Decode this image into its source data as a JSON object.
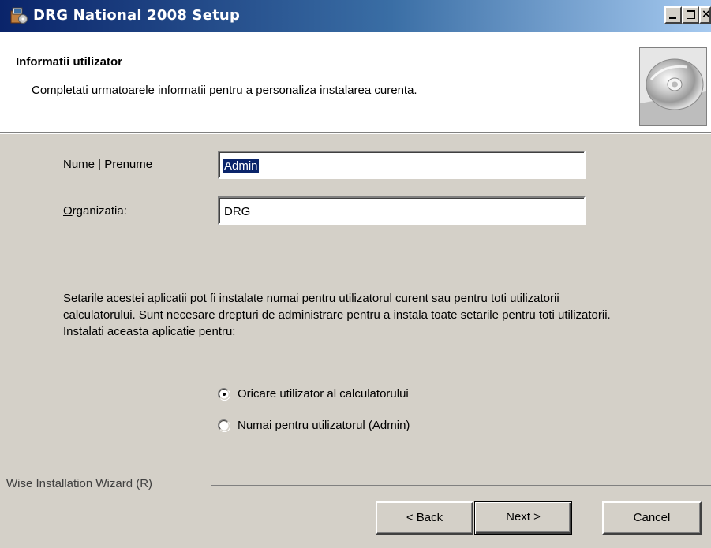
{
  "window": {
    "title": "DRG National 2008 Setup",
    "icon": "installer-icon",
    "controls": {
      "minimize": "minimize-icon",
      "maximize": "maximize-icon",
      "close": "×"
    }
  },
  "header": {
    "title": "Informatii utilizator",
    "subtitle": "Completati urmatoarele informatii pentru a personaliza instalarea curenta.",
    "image": "cd-disc-icon"
  },
  "form": {
    "name_label": "Nume | Prenume",
    "name_value": "Admin",
    "org_label_mnemonic": "O",
    "org_label_rest": "rganizatia:",
    "org_value": "DRG"
  },
  "description": {
    "line1": "Setarile acestei aplicatii pot fi instalate numai pentru utilizatorul curent sau pentru toti utilizatorii",
    "line2": "calculatorului. Sunt necesare drepturi de administrare pentru a instala  toate setarile pentru toti utilizatorii. Instalati aceasta aplicatie pentru:"
  },
  "options": [
    {
      "label": "Oricare utilizator al calculatorului",
      "selected": true
    },
    {
      "label": "Numai pentru utilizatorul (Admin)",
      "selected": false
    }
  ],
  "footer": {
    "branding": "Wise Installation Wizard (R)",
    "back_label": "< Back",
    "next_label": "Next >",
    "cancel_label": "Cancel"
  },
  "colors": {
    "titlebar_start": "#0a246a",
    "titlebar_end": "#a6caf0",
    "dialog_face": "#d4d0c8",
    "selection": "#0a246a"
  }
}
